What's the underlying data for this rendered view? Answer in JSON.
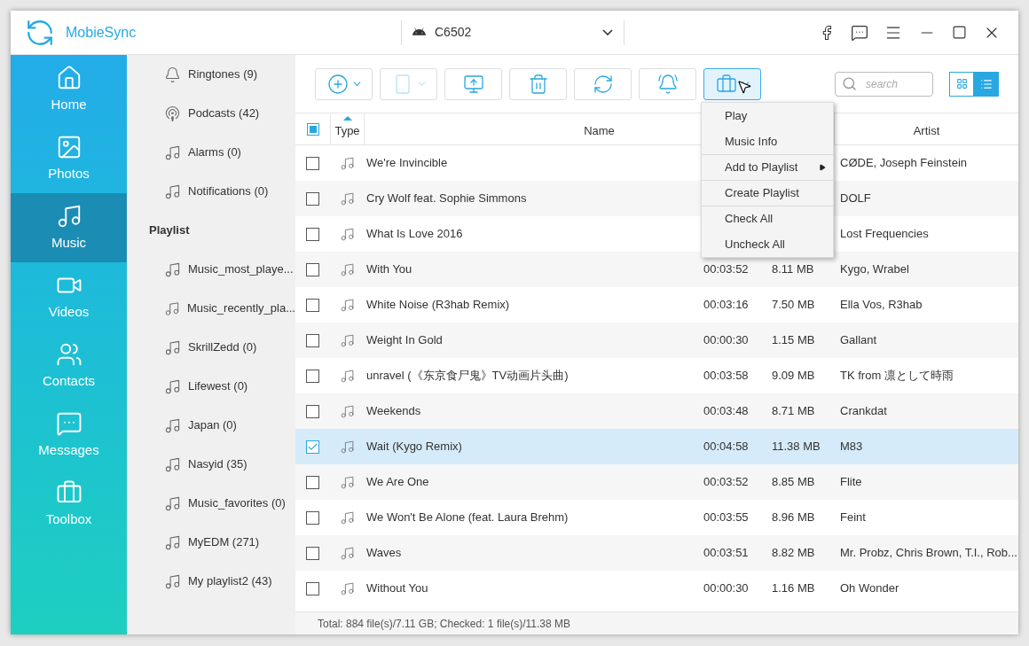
{
  "app": {
    "name": "MobieSync",
    "device": "C6502"
  },
  "nav": [
    {
      "label": "Home",
      "selected": false
    },
    {
      "label": "Photos",
      "selected": false
    },
    {
      "label": "Music",
      "selected": true
    },
    {
      "label": "Videos",
      "selected": false
    },
    {
      "label": "Contacts",
      "selected": false
    },
    {
      "label": "Messages",
      "selected": false
    },
    {
      "label": "Toolbox",
      "selected": false
    }
  ],
  "categories": [
    {
      "label": "Ringtones (9)",
      "kind": "bell"
    },
    {
      "label": "Podcasts (42)",
      "kind": "podcast"
    },
    {
      "label": "Alarms (0)",
      "kind": "music"
    },
    {
      "label": "Notifications (0)",
      "kind": "music"
    }
  ],
  "playlist_heading": "Playlist",
  "playlists": [
    "Music_most_playe...",
    "Music_recently_pla...",
    "SkrillZedd (0)",
    "Lifewest (0)",
    "Japan (0)",
    "Nasyid (35)",
    "Music_favorites (0)",
    "MyEDM (271)",
    "My playlist2 (43)"
  ],
  "toolbar": [
    {
      "disabled": false,
      "dropdown": true,
      "active": false
    },
    {
      "disabled": true,
      "dropdown": true,
      "active": false
    },
    {
      "disabled": false,
      "dropdown": false,
      "active": false
    },
    {
      "disabled": false,
      "dropdown": false,
      "active": false
    },
    {
      "disabled": false,
      "dropdown": false,
      "active": false
    },
    {
      "disabled": false,
      "dropdown": false,
      "active": false
    },
    {
      "disabled": false,
      "dropdown": true,
      "active": true
    }
  ],
  "search": {
    "placeholder": "search"
  },
  "view": [
    {
      "kind": "grid",
      "selected": false
    },
    {
      "kind": "list",
      "selected": true
    }
  ],
  "table": {
    "check_all": {
      "indeterminate": true
    },
    "columns": [
      {
        "label": "Type",
        "sorted": true
      },
      {
        "label": "Name",
        "sorted": false
      },
      {
        "label": "Artist",
        "sorted": false
      }
    ],
    "rows": [
      {
        "checked": false,
        "name": "We're Invincible",
        "artist": "CØDE, Joseph Feinstein"
      },
      {
        "checked": false,
        "name": "Cry Wolf feat. Sophie Simmons",
        "artist": "DOLF"
      },
      {
        "checked": false,
        "name": "What Is Love 2016",
        "artist": "Lost Frequencies"
      },
      {
        "checked": false,
        "name": "With You",
        "time": "00:03:52",
        "size": "8.11 MB",
        "artist": "Kygo, Wrabel"
      },
      {
        "checked": false,
        "name": "White Noise (R3hab Remix)",
        "time": "00:03:16",
        "size": "7.50 MB",
        "artist": "Ella Vos, R3hab"
      },
      {
        "checked": false,
        "name": "Weight In Gold",
        "time": "00:00:30",
        "size": "1.15 MB",
        "artist": "Gallant"
      },
      {
        "checked": false,
        "name": "unravel (《东京食尸鬼》TV动画片头曲)",
        "time": "00:03:58",
        "size": "9.09 MB",
        "artist": "TK from 凛として時雨"
      },
      {
        "checked": false,
        "name": "Weekends",
        "time": "00:03:48",
        "size": "8.71 MB",
        "artist": "Crankdat"
      },
      {
        "checked": true,
        "name": "Wait (Kygo Remix)",
        "time": "00:04:58",
        "size": "11.38 MB",
        "artist": "M83"
      },
      {
        "checked": false,
        "name": "We Are One",
        "time": "00:03:52",
        "size": "8.85 MB",
        "artist": "Flite"
      },
      {
        "checked": false,
        "name": "We Won't Be Alone (feat. Laura Brehm)",
        "time": "00:03:55",
        "size": "8.96 MB",
        "artist": "Feint"
      },
      {
        "checked": false,
        "name": "Waves",
        "time": "00:03:51",
        "size": "8.82 MB",
        "artist": "Mr. Probz, Chris Brown, T.I., Rob..."
      },
      {
        "checked": false,
        "name": "Without You",
        "time": "00:00:30",
        "size": "1.16 MB",
        "artist": "Oh Wonder"
      }
    ]
  },
  "menu": [
    {
      "label": "Play",
      "divider_before": false,
      "submenu": false
    },
    {
      "label": "Music Info",
      "divider_before": false,
      "submenu": false
    },
    {
      "label": "Add to Playlist",
      "divider_before": true,
      "submenu": true
    },
    {
      "label": "Create Playlist",
      "divider_before": true,
      "submenu": false
    },
    {
      "label": "Check All",
      "divider_before": true,
      "submenu": false
    },
    {
      "label": "Uncheck All",
      "divider_before": false,
      "submenu": false
    }
  ],
  "status_bar": "Total: 884 file(s)/7.11 GB; Checked: 1 file(s)/11.38 MB"
}
